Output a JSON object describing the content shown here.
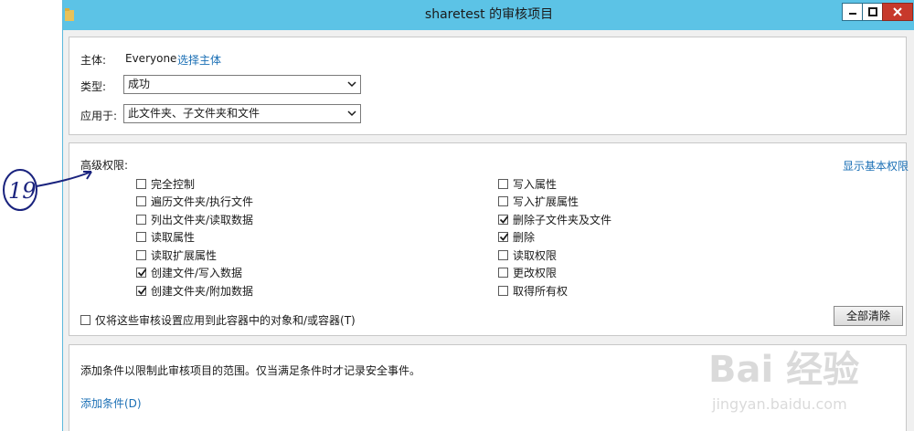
{
  "window": {
    "title": "sharetest 的审核项目"
  },
  "principal": {
    "label": "主体:",
    "value": "Everyone",
    "select_link": "选择主体"
  },
  "type": {
    "label": "类型:",
    "value": "成功"
  },
  "applies_to": {
    "label": "应用于:",
    "value": "此文件夹、子文件夹和文件"
  },
  "permissions": {
    "title": "高级权限:",
    "show_basic_link": "显示基本权限",
    "left": [
      {
        "label": "完全控制",
        "checked": false
      },
      {
        "label": "遍历文件夹/执行文件",
        "checked": false
      },
      {
        "label": "列出文件夹/读取数据",
        "checked": false
      },
      {
        "label": "读取属性",
        "checked": false
      },
      {
        "label": "读取扩展属性",
        "checked": false
      },
      {
        "label": "创建文件/写入数据",
        "checked": true
      },
      {
        "label": "创建文件夹/附加数据",
        "checked": true
      }
    ],
    "right": [
      {
        "label": "写入属性",
        "checked": false
      },
      {
        "label": "写入扩展属性",
        "checked": false
      },
      {
        "label": "删除子文件夹及文件",
        "checked": true
      },
      {
        "label": "删除",
        "checked": true
      },
      {
        "label": "读取权限",
        "checked": false
      },
      {
        "label": "更改权限",
        "checked": false
      },
      {
        "label": "取得所有权",
        "checked": false
      }
    ],
    "apply_only": {
      "label": "仅将这些审核设置应用到此容器中的对象和/或容器(T)",
      "checked": false
    },
    "clear_all_button": "全部清除"
  },
  "conditions": {
    "description": "添加条件以限制此审核项目的范围。仅当满足条件时才记录安全事件。",
    "add_link": "添加条件(D)"
  },
  "annotation": {
    "text": "19"
  },
  "watermark": {
    "brand": "Bai 经验",
    "url": "jingyan.baidu.com"
  }
}
